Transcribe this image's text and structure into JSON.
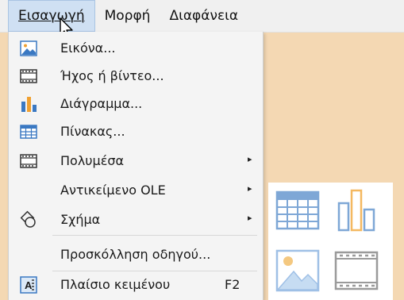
{
  "menubar": {
    "items": [
      {
        "label": "Εισαγωγή"
      },
      {
        "label": "Μορφή"
      },
      {
        "label": "Διαφάνεια"
      }
    ]
  },
  "menu": {
    "items": [
      {
        "label": "Εικόνα...",
        "icon": "picture-icon"
      },
      {
        "label": "Ήχος ή βίντεο...",
        "icon": "film-icon"
      },
      {
        "label": "Διάγραμμα...",
        "icon": "bar-chart-icon"
      },
      {
        "label": "Πίνακας...",
        "icon": "table-icon"
      },
      {
        "label": "Πολυμέσα",
        "icon": "film-icon",
        "submenu": true
      },
      {
        "label": "Αντικείμενο OLE",
        "submenu": true
      },
      {
        "label": "Σχήμα",
        "icon": "shapes-icon",
        "submenu": true
      },
      {
        "label": "Προσκόλληση οδηγού..."
      },
      {
        "label": "Πλαίσιο κειμένου",
        "icon": "text-box-icon",
        "shortcut": "F2"
      }
    ],
    "submenu_arrow": "▸"
  },
  "icon_panel": {
    "icons": [
      "table-icon",
      "bar-chart-icon",
      "picture-icon",
      "film-icon"
    ]
  },
  "colors": {
    "background": "#f4d8b3",
    "menu_bg": "#f4f4f4",
    "active_menubar": "#cfe0f3",
    "icon_blue": "#3a78c2",
    "icon_orange": "#f0a030"
  }
}
